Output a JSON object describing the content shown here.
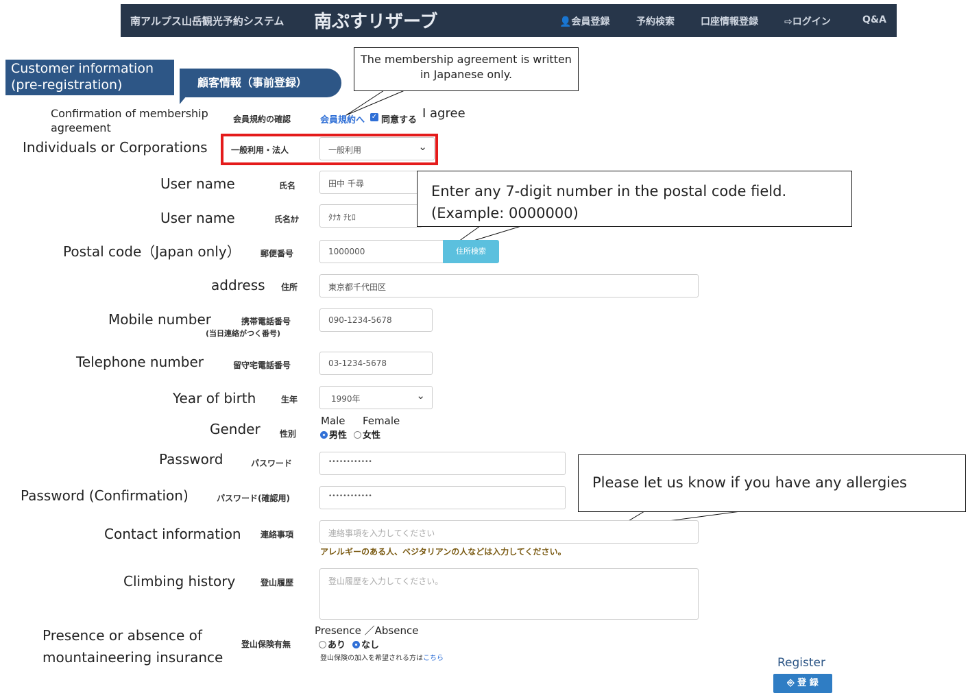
{
  "nav": {
    "system_name": "南アルプス山岳観光予約システム",
    "brand": "南ぷすリザーブ",
    "items": [
      "会員登録",
      "予約検索",
      "口座情報登録",
      "ログイン",
      "Q&A"
    ]
  },
  "section": {
    "en_title": "Customer information (pre-registration)",
    "jp_title": "顧客情報（事前登録）"
  },
  "callouts": {
    "agreement": "The membership agreement is written in Japanese only.",
    "postal": "Enter any 7-digit number in the postal code field. (Example: 0000000)",
    "allergy": "Please let us know if you have any allergies"
  },
  "fields": {
    "agreement": {
      "en": "Confirmation of membership agreement",
      "jp": "会員規約の確認",
      "link": "会員規約へ",
      "check_label": "同意する",
      "check_en": "I agree",
      "checked": true
    },
    "usage": {
      "en": "Individuals or Corporations",
      "jp": "一般利用・法人",
      "value": "一般利用"
    },
    "name": {
      "en": "User name",
      "jp": "氏名",
      "value": "田中 千尋"
    },
    "name_kana": {
      "en": "User name",
      "jp": "氏名ｶﾅ",
      "value": "ﾀﾅｶ ﾁﾋﾛ"
    },
    "postal": {
      "en": "Postal code（Japan only）",
      "jp": "郵便番号",
      "value": "1000000",
      "button": "住所検索"
    },
    "address": {
      "en": "address",
      "jp": "住所",
      "value": "東京都千代田区"
    },
    "mobile": {
      "en": "Mobile number",
      "jp": "携帯電話番号",
      "jp_note": "(当日連絡がつく番号)",
      "value": "090-1234-5678"
    },
    "phone": {
      "en": "Telephone number",
      "jp": "留守宅電話番号",
      "value": "03-1234-5678"
    },
    "birth_year": {
      "en": "Year of birth",
      "jp": "生年",
      "value": "1990年"
    },
    "gender": {
      "en": "Gender",
      "jp": "性別",
      "option_en_1": "Male",
      "option_en_2": "Female",
      "option_1": "男性",
      "option_2": "女性",
      "selected": "男性"
    },
    "password": {
      "en": "Password",
      "jp": "パスワード",
      "value": "••••••••••••"
    },
    "password_confirm": {
      "en": "Password (Confirmation)",
      "jp": "パスワード(確認用)",
      "value": "••••••••••••"
    },
    "contact": {
      "en": "Contact information",
      "jp": "連絡事項",
      "placeholder": "連絡事項を入力してください",
      "note": "アレルギーのある人、ベジタリアンの人などは入力してください。"
    },
    "climbing": {
      "en": "Climbing history",
      "jp": "登山履歴",
      "placeholder": "登山履歴を入力してください。"
    },
    "insurance": {
      "en": "Presence or absence of mountaineering insurance",
      "jp": "登山保険有無",
      "options_en": "Presence ／Absence",
      "option_1": "あり",
      "option_2": "なし",
      "selected": "なし",
      "note": "登山保険の加入を希望される方は",
      "note_link": "こちら"
    }
  },
  "register": {
    "en": "Register",
    "button": "登 録"
  },
  "colors": {
    "nav_bg": "#27364a",
    "section_bg": "#2d5686",
    "highlight": "#e41b1b",
    "accent": "#2f6fd6"
  }
}
